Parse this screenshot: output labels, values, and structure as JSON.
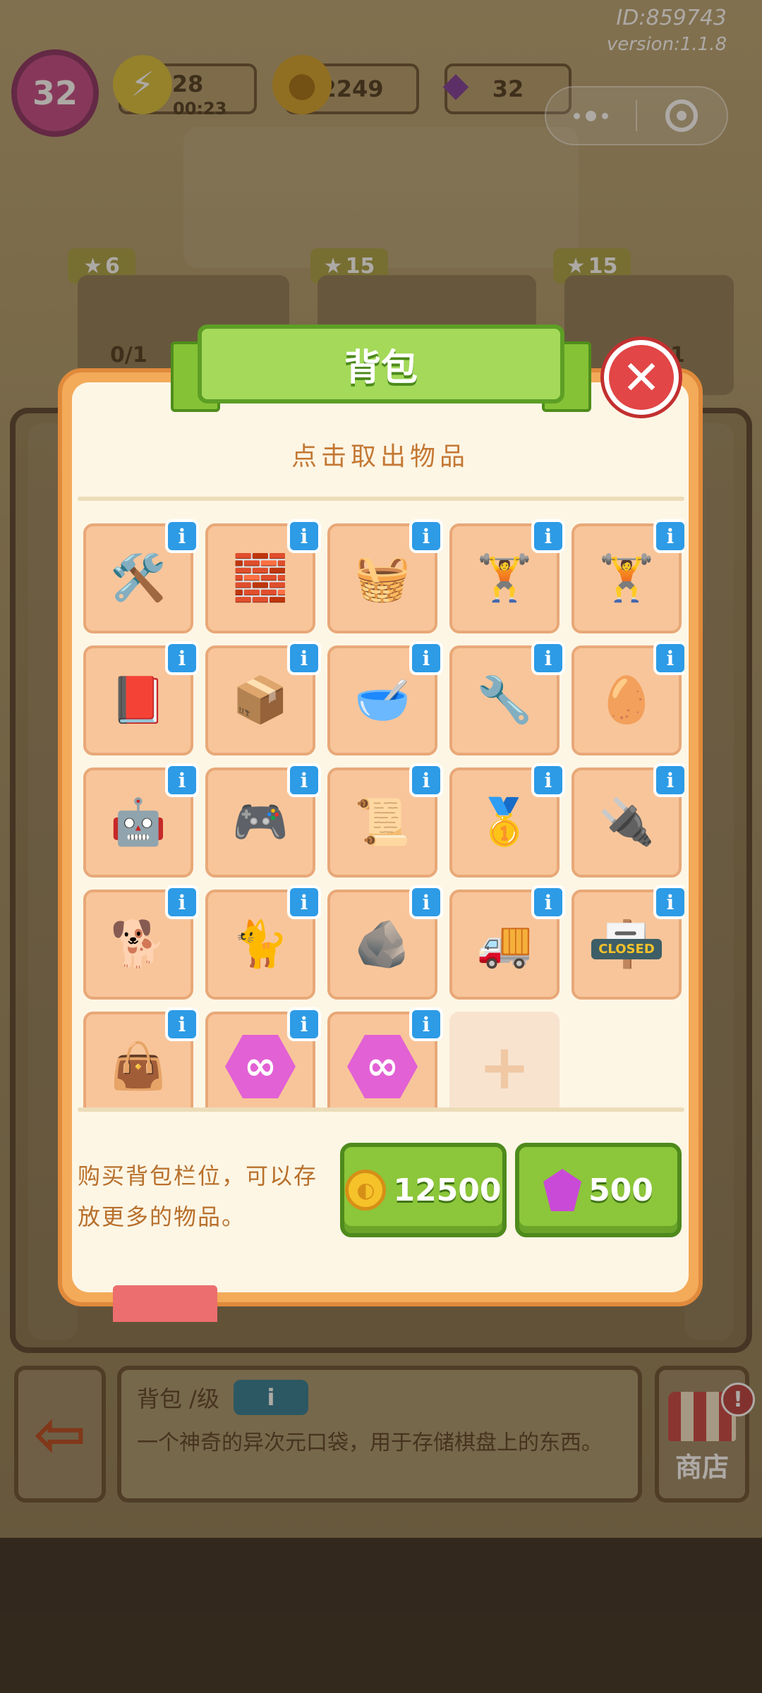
{
  "hud": {
    "level": "32",
    "energy": "28",
    "energy_timer": "00:23",
    "coins": "2249",
    "gems": "32",
    "id_label": "ID:859743",
    "version_label": "version:1.1.8"
  },
  "orders": [
    {
      "stars": "6",
      "progress": "0/1"
    },
    {
      "stars": "15"
    },
    {
      "stars": "15",
      "progress": "1"
    }
  ],
  "modal": {
    "title": "背包",
    "subtitle": "点击取出物品",
    "items": [
      {
        "name": "shovel",
        "icon": "🛠️"
      },
      {
        "name": "bricks",
        "icon": "🧱"
      },
      {
        "name": "basket",
        "icon": "🧺"
      },
      {
        "name": "bench-press",
        "icon": "🏋️"
      },
      {
        "name": "barbell-stand",
        "icon": "🏋️"
      },
      {
        "name": "book",
        "icon": "📕"
      },
      {
        "name": "cardboard-box",
        "icon": "📦"
      },
      {
        "name": "mortar-pestle",
        "icon": "🥣"
      },
      {
        "name": "drill",
        "icon": "🔧"
      },
      {
        "name": "egg-hatch",
        "icon": "🥚"
      },
      {
        "name": "robot-arm-toy",
        "icon": "🤖"
      },
      {
        "name": "handheld-console",
        "icon": "🎮"
      },
      {
        "name": "scroll",
        "icon": "📜"
      },
      {
        "name": "gold-medal",
        "icon": "🥇"
      },
      {
        "name": "circuit-board",
        "icon": "🔌"
      },
      {
        "name": "shiba-dog",
        "icon": "🐕"
      },
      {
        "name": "sleeping-cat",
        "icon": "🐈"
      },
      {
        "name": "mossy-stone",
        "icon": "🪨"
      },
      {
        "name": "toy-truck",
        "icon": "🚚"
      },
      {
        "name": "closed-sign",
        "icon": "🪧",
        "text": "CLOSED"
      },
      {
        "name": "pink-bag",
        "icon": "👜"
      },
      {
        "name": "infinity-gem-1",
        "icon": "∞"
      },
      {
        "name": "infinity-gem-2",
        "icon": "∞"
      }
    ],
    "empty_slot_icon": "+",
    "info_glyph": "i",
    "buy_text": "购买背包栏位，可以存放更多的物品。",
    "buy_coin_price": "12500",
    "buy_gem_price": "500",
    "close_glyph": "✕"
  },
  "info_panel": {
    "title": "背包 /级",
    "info_glyph": "i",
    "description": "一个神奇的异次元口袋，用于存储棋盘上的东西。"
  },
  "shop": {
    "label": "商店",
    "alert": "!"
  },
  "colors": {
    "modal_orange": "#f3aa59",
    "ribbon_green": "#a4d95a",
    "button_green": "#8cc63a",
    "info_blue": "#2d9be6",
    "close_red": "#e24646",
    "slot_peach": "#f8c59a"
  }
}
